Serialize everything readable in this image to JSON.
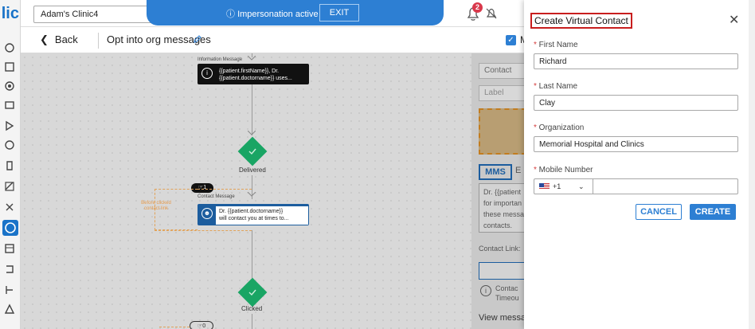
{
  "top_bar": {
    "clinic_select": "Adam's Clinic4",
    "impersonation_text": "Impersonation active",
    "exit_label": "EXIT",
    "notification_count": "2"
  },
  "sub_header": {
    "back_label": "Back",
    "flow_title": "Opt into org messages",
    "checkbox_label": "M"
  },
  "canvas": {
    "info_caption": "Information Message",
    "info_text_1": "{{patient.firstName}}, Dr.",
    "info_text_2": "{{patient.doctorname}} uses...",
    "delivered_label": "Delivered",
    "contact_caption": "Contact Message",
    "contact_text_1": "Dr. {{patient.doctorname}}",
    "contact_text_2": "will contact you at times to...",
    "before_clicked_1": "Before clicked",
    "before_clicked_2": "contact link",
    "pill_count_top": "1",
    "pill_count_bottom": "0",
    "clicked_label": "Clicked"
  },
  "behind_panel": {
    "contact_placeholder": "Contact",
    "label_placeholder": "Label",
    "tab_mms": "MMS",
    "tab_e": "E",
    "msg_line_1": "Dr. {{patient",
    "msg_line_2": "for importan",
    "msg_line_3": "these messa",
    "msg_line_4": "contacts.",
    "contact_link_label": "Contact Link:",
    "info_line_1": "Contac",
    "info_line_2": "Timeou",
    "view_messages": "View messa"
  },
  "modal": {
    "title": "Create Virtual Contact",
    "first_name_label": "First Name",
    "first_name_value": "Richard",
    "last_name_label": "Last Name",
    "last_name_value": "Clay",
    "organization_label": "Organization",
    "organization_value": "Memorial Hospital and Clinics",
    "mobile_label": "Mobile Number",
    "country_code": "+1",
    "mobile_value": "",
    "cancel_label": "CANCEL",
    "create_label": "CREATE"
  },
  "colors": {
    "accent": "#2d7fd3",
    "title_outline": "#c81e1e",
    "success": "#19a564",
    "warning_dash": "#e1a35a"
  }
}
